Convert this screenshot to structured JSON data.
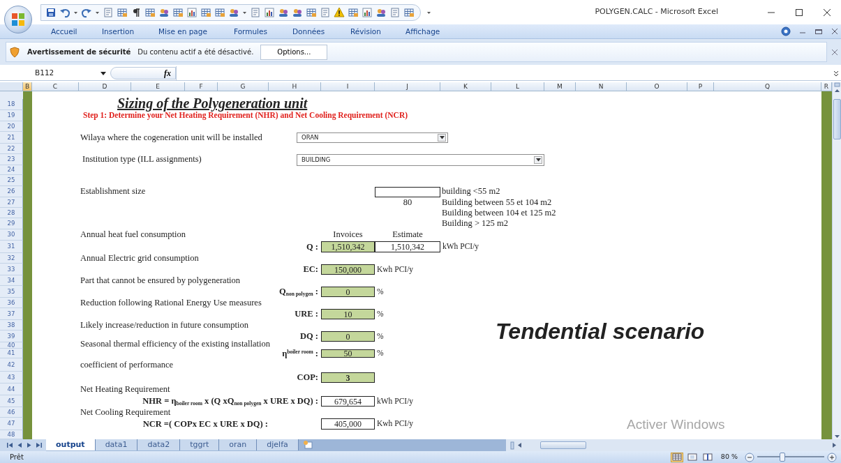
{
  "window": {
    "title": "POLYGEN.CALC - Microsoft Excel"
  },
  "ribbon_tabs": [
    "Accueil",
    "Insertion",
    "Mise en page",
    "Formules",
    "Données",
    "Révision",
    "Affichage"
  ],
  "security_bar": {
    "title": "Avertissement de sécurité",
    "message": "Du contenu actif a été désactivé.",
    "button": "Options..."
  },
  "formula_bar": {
    "name_box": "B112",
    "function_button": "fx"
  },
  "column_headers": [
    {
      "label": "B",
      "selected": true
    },
    {
      "label": "C",
      "selected": false
    },
    {
      "label": "D",
      "selected": false
    },
    {
      "label": "E",
      "selected": false
    },
    {
      "label": "F",
      "selected": false
    },
    {
      "label": "G",
      "selected": false
    },
    {
      "label": "H",
      "selected": false
    },
    {
      "label": "I",
      "selected": false
    },
    {
      "label": "J",
      "selected": false
    },
    {
      "label": "K",
      "selected": false
    },
    {
      "label": "L",
      "selected": false
    },
    {
      "label": "M",
      "selected": false
    },
    {
      "label": "N",
      "selected": false
    },
    {
      "label": "O",
      "selected": false
    },
    {
      "label": "P",
      "selected": false
    },
    {
      "label": "Q",
      "selected": false
    },
    {
      "label": "R",
      "selected": false
    }
  ],
  "row_headers": [
    "18",
    "19",
    "20",
    "21",
    "22",
    "23",
    "24",
    "25",
    "26",
    "27",
    "28",
    "29",
    "30",
    "31",
    "32",
    "33",
    "34",
    "35",
    "36",
    "37",
    "38",
    "39",
    "40",
    "41",
    "42",
    "43",
    "44",
    "45",
    "46",
    "47",
    "48"
  ],
  "sheet": {
    "title": "Sizing of the Polygeneration unit",
    "step": "Step 1: Determine your Net Heating Requirement (NHR) and Net Cooling Requirement (NCR)",
    "location": {
      "label": "Wilaya where the cogeneration unit will be installed",
      "value": "ORAN"
    },
    "institution": {
      "label": "Institution type (ILL assignments)",
      "value": "BUILDING"
    },
    "establishment": {
      "label": "Establishment size",
      "value": "80",
      "sizes": [
        "building <55 m2",
        "Building between 55 et 104 m2",
        "Building between 104 et 125 m2",
        "Building > 125 m2"
      ]
    },
    "heat": {
      "label": "Annual heat fuel consumption",
      "headers": [
        "Invoices",
        "Estimate"
      ],
      "symbol": "Q :",
      "invoices": "1,510,342",
      "estimate": "1,510,342",
      "unit": "kWh PCI/y"
    },
    "parameters": [
      {
        "kind": "input",
        "label": "Annual Electric grid  consumption",
        "symbol": "EC:",
        "value": "150,000",
        "unit": "Kwh PCI/y",
        "bold": false
      },
      {
        "kind": "input",
        "label": "Part that cannot be ensured by polygeneration",
        "symbol": "Q$_{non polygen}$ :",
        "value": "0",
        "unit": "%",
        "bold": false
      },
      {
        "kind": "input",
        "label": "Reduction following Rational Energy Use measures",
        "symbol": "URE :",
        "value": "10",
        "unit": "%",
        "bold": false
      },
      {
        "kind": "input",
        "label": "Likely increase/reduction in future consumption",
        "symbol": "DQ :",
        "value": "0",
        "unit": "%",
        "bold": false
      },
      {
        "kind": "input",
        "label": "Seasonal thermal efficiency of the existing installation",
        "symbol": "η$^{boiler room}$ :",
        "value": "50",
        "unit": "%",
        "bold": false
      },
      {
        "kind": "input",
        "label": "coefficient of performance",
        "symbol": "COP:",
        "value": "3",
        "bold": true
      },
      {
        "kind": "result",
        "label": "Net Heating Requirement",
        "symbol": "NHR = η$_{boiler room}$ x (Q xQ$_{non polygen}$ x URE x DQ) :",
        "value": "679,654",
        "unit": "kWh PCI/y",
        "bold": false
      },
      {
        "kind": "result",
        "label": "Net Cooling Requirement",
        "symbol": "NCR =( COPx EC x URE x DQ) :",
        "value": "405,000",
        "unit": "Kwh PCI/y",
        "bold": false
      }
    ],
    "scenario": "Tendential scenario"
  },
  "activation_notice": "Activer Windows",
  "sheet_tabs": [
    {
      "label": "output",
      "selected": true
    },
    {
      "label": "data1",
      "selected": false
    },
    {
      "label": "data2",
      "selected": false
    },
    {
      "label": "tggrt",
      "selected": false
    },
    {
      "label": "oran",
      "selected": false
    },
    {
      "label": "djelfa",
      "selected": false
    }
  ],
  "status_bar": {
    "text": "Prêt",
    "views": [
      {
        "selected": true
      },
      {
        "selected": false
      },
      {
        "selected": false
      }
    ],
    "zoom": "80 %",
    "zoom_slider": {
      "level": 0.38
    }
  }
}
